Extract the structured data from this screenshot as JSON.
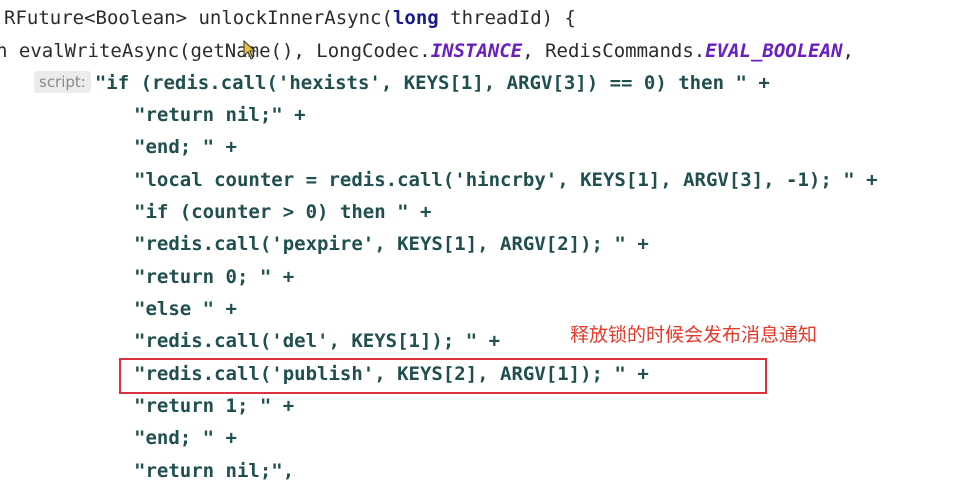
{
  "code": {
    "line1": {
      "prefix": "RFuture<Boolean> unlockInnerAsync(",
      "keyword": "long",
      "suffix": " threadId) {"
    },
    "line2": {
      "prefix": "n evalWriteAsync(getName(), LongCodec.",
      "const1": "INSTANCE",
      "middle": ", RedisCommands.",
      "const2": "EVAL_BOOLEAN",
      "suffix": ","
    },
    "line3": {
      "hint": "script:",
      "text": "\"if (redis.call('hexists', KEYS[1], ARGV[3]) == 0) then \" +"
    },
    "lines": [
      "\"return nil;\" +",
      "\"end; \" +",
      "\"local counter = redis.call('hincrby', KEYS[1], ARGV[3], -1); \" +",
      "\"if (counter > 0) then \" +",
      "\"redis.call('pexpire', KEYS[1], ARGV[2]); \" +",
      "\"return 0; \" +",
      "\"else \" +",
      "\"redis.call('del', KEYS[1]); \" +",
      "\"redis.call('publish', KEYS[2], ARGV[1]); \" +",
      "\"return 1; \" +",
      "\"end; \" +",
      "\"return nil;\","
    ]
  },
  "annotation": "释放锁的时候会发布消息通知",
  "colors": {
    "highlight_border": "#d8333f",
    "annotation_text": "#e53a2a"
  }
}
